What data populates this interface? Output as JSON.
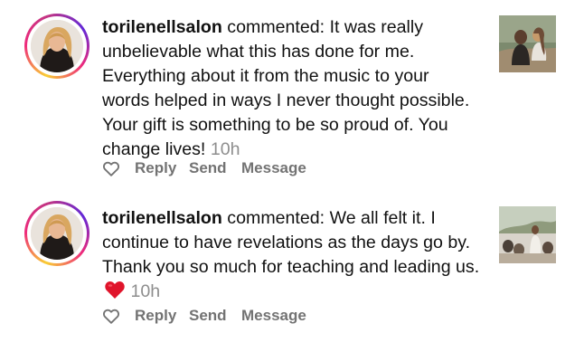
{
  "notifications": [
    {
      "username": "torilenellsalon",
      "action": "commented:",
      "comment": "It was really unbelievable what this has done for me. Everything about it from the music to your words helped in ways I never thought possible. Your gift is something to be so proud of. You change lives!",
      "time": "10h",
      "actions": {
        "reply": "Reply",
        "send": "Send",
        "message": "Message"
      }
    },
    {
      "username": "torilenellsalon",
      "action": "commented:",
      "comment": "We all felt it. I continue to have revelations as the days go by. Thank you so much for teaching and leading us.",
      "emoji": "heart",
      "time": "10h",
      "actions": {
        "reply": "Reply",
        "send": "Send",
        "message": "Message"
      }
    }
  ],
  "colors": {
    "text": "#111111",
    "muted": "#8e8e8e",
    "action": "#737373",
    "heart": "#e0142b"
  }
}
